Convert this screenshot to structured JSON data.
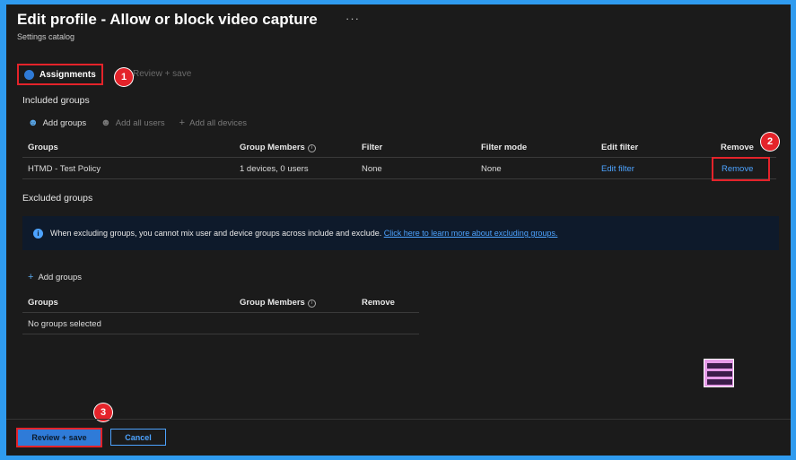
{
  "header": {
    "title": "Edit profile - Allow or block video capture",
    "more_icon": "ellipsis-icon",
    "subtitle": "Settings catalog"
  },
  "tabs": [
    {
      "label": "Assignments",
      "step": "1",
      "state": "active"
    },
    {
      "label": "Review + save",
      "state": "inactive"
    }
  ],
  "callouts": [
    "1",
    "2",
    "3"
  ],
  "included": {
    "heading": "Included groups",
    "actions": [
      {
        "label": "Add groups",
        "icon": "user-add-icon",
        "enabled": true
      },
      {
        "label": "Add all users",
        "icon": "users-icon",
        "enabled": false
      },
      {
        "label": "Add all devices",
        "icon": "plus-icon",
        "enabled": false
      }
    ],
    "columns": [
      "Groups",
      "Group Members",
      "Filter",
      "Filter mode",
      "Edit filter",
      "Remove"
    ],
    "rows": [
      {
        "group": "HTMD - Test Policy",
        "members": "1 devices, 0 users",
        "filter": "None",
        "filter_mode": "None",
        "edit_filter": "Edit filter",
        "remove": "Remove"
      }
    ]
  },
  "excluded": {
    "heading": "Excluded groups",
    "banner_text": "When excluding groups, you cannot mix user and device groups across include and exclude.",
    "banner_link": "Click here to learn more about excluding groups.",
    "add_label": "Add groups",
    "columns": [
      "Groups",
      "Group Members",
      "Remove"
    ],
    "empty_text": "No groups selected"
  },
  "footer": {
    "primary": "Review + save",
    "secondary": "Cancel"
  },
  "colors": {
    "accent": "#2f7bd8",
    "link": "#4da3ff",
    "highlight": "#e4232a",
    "background": "#1b1b1b"
  }
}
